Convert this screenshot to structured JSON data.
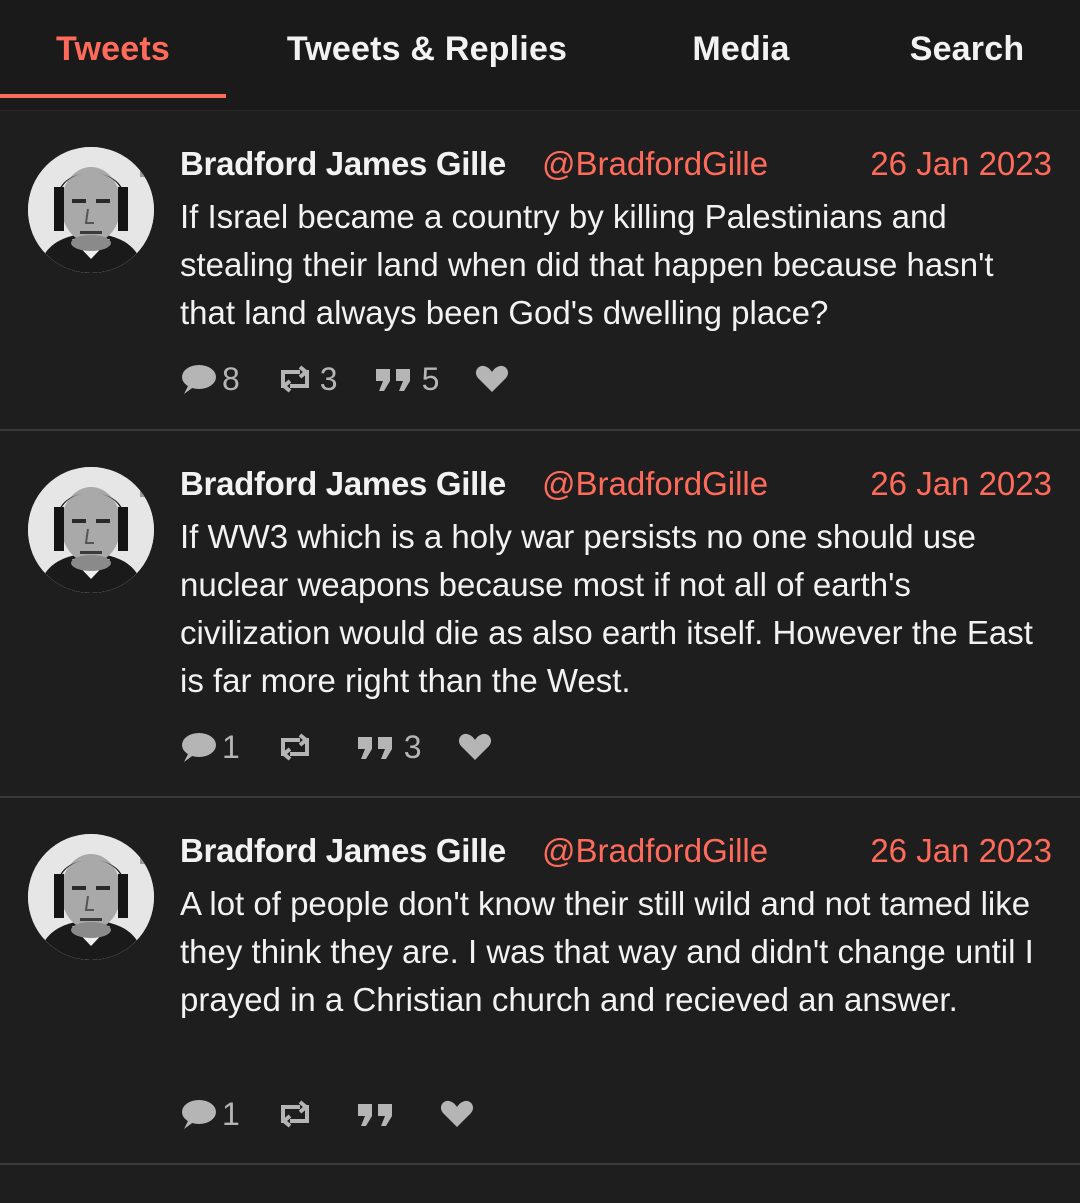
{
  "tabs": [
    {
      "label": "Tweets",
      "active": true
    },
    {
      "label": "Tweets & Replies",
      "active": false
    },
    {
      "label": "Media",
      "active": false
    },
    {
      "label": "Search",
      "active": false
    }
  ],
  "colors": {
    "accent": "#ff6b5b",
    "background": "#1e1e1e",
    "text": "#f2f2f2",
    "muted": "#b5b5b5"
  },
  "tweets": [
    {
      "fullname": "Bradford James Gille",
      "username": "@BradfordGille",
      "date": "26 Jan 2023",
      "text": "If Israel became a country by killing Palestinians and stealing their land when did that happen because hasn't that land always been God's dwelling place?",
      "replies": "8",
      "retweets": "3",
      "quotes": "5",
      "likes": ""
    },
    {
      "fullname": "Bradford James Gille",
      "username": "@BradfordGille",
      "date": "26 Jan 2023",
      "text": "If WW3 which is a holy war persists no one should use nuclear weapons because most if not all of earth's civilization would die as also earth itself. However the East is far more right than the West.",
      "replies": "1",
      "retweets": "",
      "quotes": "3",
      "likes": ""
    },
    {
      "fullname": "Bradford James Gille",
      "username": "@BradfordGille",
      "date": "26 Jan 2023",
      "text": "A lot of people don't know their still wild and not tamed like they think they are. I was that way and didn't change until I prayed in a Christian church and recieved an answer.",
      "replies": "1",
      "retweets": "",
      "quotes": "",
      "likes": ""
    }
  ]
}
